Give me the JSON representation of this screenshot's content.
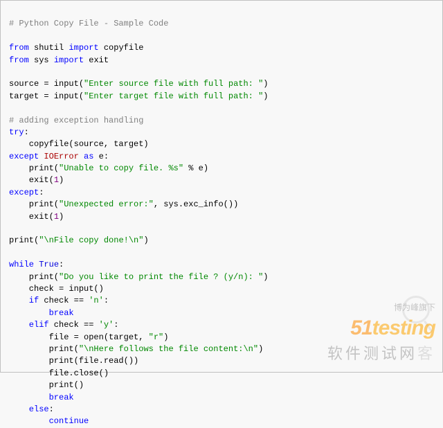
{
  "code": {
    "l1": "# Python Copy File - Sample Code",
    "l2_from": "from",
    "l2_mod": " shutil ",
    "l2_imp": "import",
    "l2_fn": " copyfile",
    "l3_from": "from",
    "l3_mod": " sys ",
    "l3_imp": "import",
    "l3_fn": " exit",
    "l4_src": "source = input(",
    "l4_str": "\"Enter source file with full path: \"",
    "l4_end": ")",
    "l5_tgt": "target = input(",
    "l5_str": "\"Enter target file with full path: \"",
    "l5_end": ")",
    "l6": "# adding exception handling",
    "l7_try": "try",
    "l7_colon": ":",
    "l8": "    copyfile(source, target)",
    "l9_exc": "except",
    "l9_ioe": " IOError ",
    "l9_as": "as",
    "l9_e": " e:",
    "l10_a": "    print(",
    "l10_str": "\"Unable to copy file. %s\"",
    "l10_b": " % e)",
    "l11_a": "    exit(",
    "l11_n": "1",
    "l11_b": ")",
    "l12_exc": "except",
    "l12_colon": ":",
    "l13_a": "    print(",
    "l13_str": "\"Unexpected error:\"",
    "l13_b": ", sys.exc_info())",
    "l14_a": "    exit(",
    "l14_n": "1",
    "l14_b": ")",
    "l15_a": "print(",
    "l15_str": "\"\\nFile copy done!\\n\"",
    "l15_b": ")",
    "l16_while": "while",
    "l16_true": " True",
    "l16_colon": ":",
    "l17_a": "    print(",
    "l17_str": "\"Do you like to print the file ? (y/n): \"",
    "l17_b": ")",
    "l18": "    check = input()",
    "l19_if": "    if",
    "l19_a": " check == ",
    "l19_str": "'n'",
    "l19_colon": ":",
    "l20_break": "        break",
    "l21_elif": "    elif",
    "l21_a": " check == ",
    "l21_str": "'y'",
    "l21_colon": ":",
    "l22_a": "        file = open(target, ",
    "l22_str": "\"r\"",
    "l22_b": ")",
    "l23_a": "        print(",
    "l23_str": "\"\\nHere follows the file content:\\n\"",
    "l23_b": ")",
    "l24": "        print(file.read())",
    "l25": "        file.close()",
    "l26": "        print()",
    "l27_break": "        break",
    "l28_else": "    else",
    "l28_colon": ":",
    "l29_cont": "        continue"
  },
  "watermark": {
    "tag": "博为峰旗下",
    "logo_5": "5",
    "logo_1": "1",
    "logo_t": "testing",
    "sub": "软件测试网",
    "sub_ext": "客"
  }
}
